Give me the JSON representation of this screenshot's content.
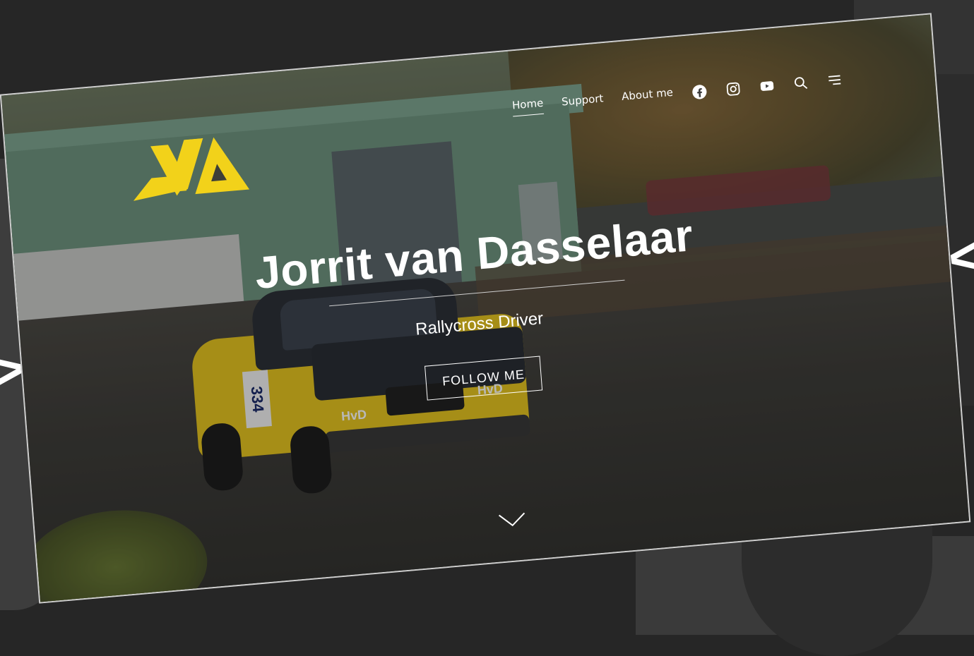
{
  "site": {
    "logo_text": "JVA",
    "accent_color": "#f2d21a"
  },
  "nav": {
    "items": [
      {
        "label": "Home",
        "active": true
      },
      {
        "label": "Support",
        "active": false
      },
      {
        "label": "About me",
        "active": false
      }
    ],
    "icons": [
      "facebook-icon",
      "instagram-icon",
      "youtube-icon",
      "search-icon",
      "menu-icon"
    ]
  },
  "hero": {
    "title": "Jorrit van Dasselaar",
    "subtitle": "Rallycross Driver",
    "button_label": "FOLLOW ME"
  },
  "photo": {
    "car_number": "334",
    "sponsor": "HvD"
  }
}
